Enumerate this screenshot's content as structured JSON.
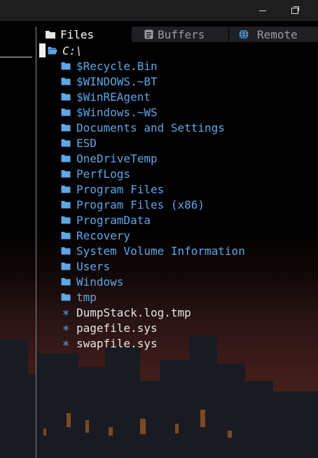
{
  "window": {
    "minimize_label": "minimize",
    "maximize_label": "restore"
  },
  "tabs": [
    {
      "label": "Files",
      "icon": "folder-icon",
      "active": true
    },
    {
      "label": "Buffers",
      "icon": "document-icon",
      "active": false
    },
    {
      "label": "Remote",
      "icon": "globe-icon",
      "active": false
    }
  ],
  "tree": {
    "root": "C:\\",
    "entries": [
      {
        "name": "$Recycle.Bin",
        "type": "dir"
      },
      {
        "name": "$WINDOWS.~BT",
        "type": "dir"
      },
      {
        "name": "$WinREAgent",
        "type": "dir"
      },
      {
        "name": "$Windows.~WS",
        "type": "dir"
      },
      {
        "name": "Documents and Settings",
        "type": "dir"
      },
      {
        "name": "ESD",
        "type": "dir"
      },
      {
        "name": "OneDriveTemp",
        "type": "dir"
      },
      {
        "name": "PerfLogs",
        "type": "dir"
      },
      {
        "name": "Program Files",
        "type": "dir"
      },
      {
        "name": "Program Files (x86)",
        "type": "dir"
      },
      {
        "name": "ProgramData",
        "type": "dir"
      },
      {
        "name": "Recovery",
        "type": "dir"
      },
      {
        "name": "System Volume Information",
        "type": "dir"
      },
      {
        "name": "Users",
        "type": "dir"
      },
      {
        "name": "Windows",
        "type": "dir"
      },
      {
        "name": "tmp",
        "type": "dir"
      },
      {
        "name": "DumpStack.log.tmp",
        "type": "file"
      },
      {
        "name": "pagefile.sys",
        "type": "file"
      },
      {
        "name": "swapfile.sys",
        "type": "file"
      }
    ]
  },
  "colors": {
    "directory": "#5ea7e6",
    "file": "#e6e6e6",
    "background": "#000000"
  }
}
